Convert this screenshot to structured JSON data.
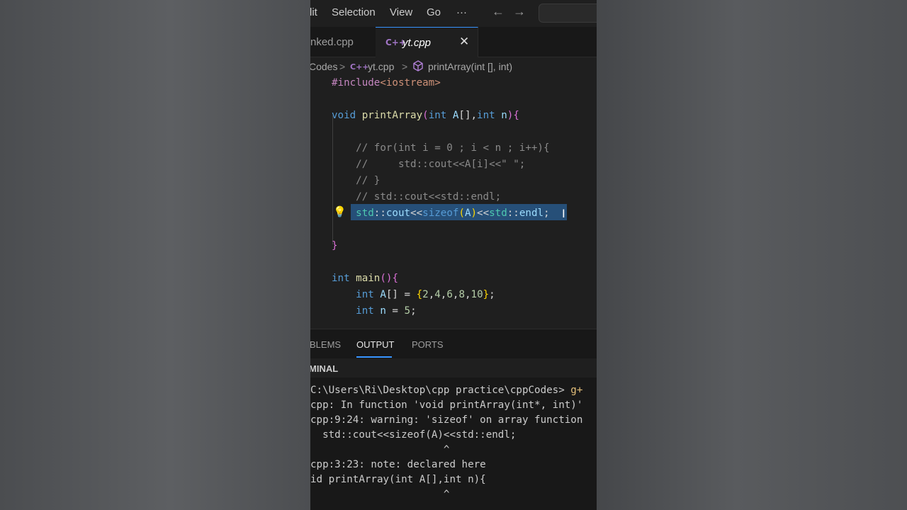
{
  "menu": {
    "items": [
      "lit",
      "Selection",
      "View",
      "Go",
      "···"
    ],
    "back": "←",
    "forward": "→"
  },
  "tabs": [
    {
      "label": "nked.cpp",
      "active": false
    },
    {
      "label": "yt.cpp",
      "active": true,
      "icon": "C++"
    }
  ],
  "tab_close": "✕",
  "breadcrumb": {
    "folder": "Codes",
    "sep1": ">",
    "file_icon": "C++",
    "file": "yt.cpp",
    "sep2": ">",
    "symbol": "printArray(int [], int)"
  },
  "editor": {
    "lines": [
      [
        {
          "t": "#include",
          "c": "t-pp"
        },
        {
          "t": "<iostream>",
          "c": "t-inc"
        }
      ],
      [],
      [
        {
          "t": "void ",
          "c": "t-kw"
        },
        {
          "t": "printArray",
          "c": "t-fn"
        },
        {
          "t": "(",
          "c": "t-br2"
        },
        {
          "t": "int ",
          "c": "t-kw"
        },
        {
          "t": "A",
          "c": "t-var"
        },
        {
          "t": "[]",
          "c": "t-op"
        },
        {
          "t": ",",
          "c": "t-op"
        },
        {
          "t": "int ",
          "c": "t-kw"
        },
        {
          "t": "n",
          "c": "t-var"
        },
        {
          "t": ")",
          "c": "t-br2"
        },
        {
          "t": "{",
          "c": "t-br2"
        }
      ],
      [],
      [
        {
          "t": "    // for(int i = 0 ; i < n ; i++){",
          "c": "t-cm"
        }
      ],
      [
        {
          "t": "    //     std::cout<<A[i]<<\" \";",
          "c": "t-cm"
        }
      ],
      [
        {
          "t": "    // }",
          "c": "t-cm"
        }
      ],
      [
        {
          "t": "    // std::cout<<std::endl;",
          "c": "t-cm"
        }
      ],
      [
        {
          "t": "    ",
          "c": "t-op"
        },
        {
          "t": "std",
          "c": "t-ns"
        },
        {
          "t": "::",
          "c": "t-op"
        },
        {
          "t": "cout",
          "c": "t-var"
        },
        {
          "t": "<<",
          "c": "t-op"
        },
        {
          "t": "sizeof",
          "c": "t-kw"
        },
        {
          "t": "(",
          "c": "t-br"
        },
        {
          "t": "A",
          "c": "t-var"
        },
        {
          "t": ")",
          "c": "t-br"
        },
        {
          "t": "<<",
          "c": "t-op"
        },
        {
          "t": "std",
          "c": "t-ns"
        },
        {
          "t": "::",
          "c": "t-op"
        },
        {
          "t": "endl",
          "c": "t-var"
        },
        {
          "t": ";",
          "c": "t-op"
        }
      ],
      [],
      [
        {
          "t": "}",
          "c": "t-br2"
        }
      ],
      [],
      [
        {
          "t": "int ",
          "c": "t-kw"
        },
        {
          "t": "main",
          "c": "t-fn"
        },
        {
          "t": "()",
          "c": "t-br2"
        },
        {
          "t": "{",
          "c": "t-br2"
        }
      ],
      [
        {
          "t": "    ",
          "c": "t-op"
        },
        {
          "t": "int ",
          "c": "t-kw"
        },
        {
          "t": "A",
          "c": "t-var"
        },
        {
          "t": "[] = ",
          "c": "t-op"
        },
        {
          "t": "{",
          "c": "t-br"
        },
        {
          "t": "2",
          "c": "t-num"
        },
        {
          "t": ",",
          "c": "t-op"
        },
        {
          "t": "4",
          "c": "t-num"
        },
        {
          "t": ",",
          "c": "t-op"
        },
        {
          "t": "6",
          "c": "t-num"
        },
        {
          "t": ",",
          "c": "t-op"
        },
        {
          "t": "8",
          "c": "t-num"
        },
        {
          "t": ",",
          "c": "t-op"
        },
        {
          "t": "10",
          "c": "t-num"
        },
        {
          "t": "}",
          "c": "t-br"
        },
        {
          "t": ";",
          "c": "t-op"
        }
      ],
      [
        {
          "t": "    ",
          "c": "t-op"
        },
        {
          "t": "int ",
          "c": "t-kw"
        },
        {
          "t": "n",
          "c": "t-var"
        },
        {
          "t": " = ",
          "c": "t-op"
        },
        {
          "t": "5",
          "c": "t-num"
        },
        {
          "t": ";",
          "c": "t-op"
        }
      ]
    ]
  },
  "panel": {
    "tabs": [
      "BLEMS",
      "OUTPUT",
      "PORTS"
    ],
    "active_tab": "OUTPUT",
    "section": "MINAL"
  },
  "terminal": {
    "lines": [
      "",
      "C:\\Users\\Ri\\Desktop\\cpp practice\\cppCodes> g+",
      "cpp: In function 'void printArray(int*, int)'",
      "cpp:9:24: warning: 'sizeof' on array function",
      "  std::cout<<sizeof(A)<<std::endl;",
      "                      ^",
      "cpp:3:23: note: declared here",
      "id printArray(int A[],int n){",
      "                      ^"
    ]
  },
  "colors": {
    "accent": "#3794ff",
    "selection": "#264f78",
    "background": "#1f1f1f"
  }
}
